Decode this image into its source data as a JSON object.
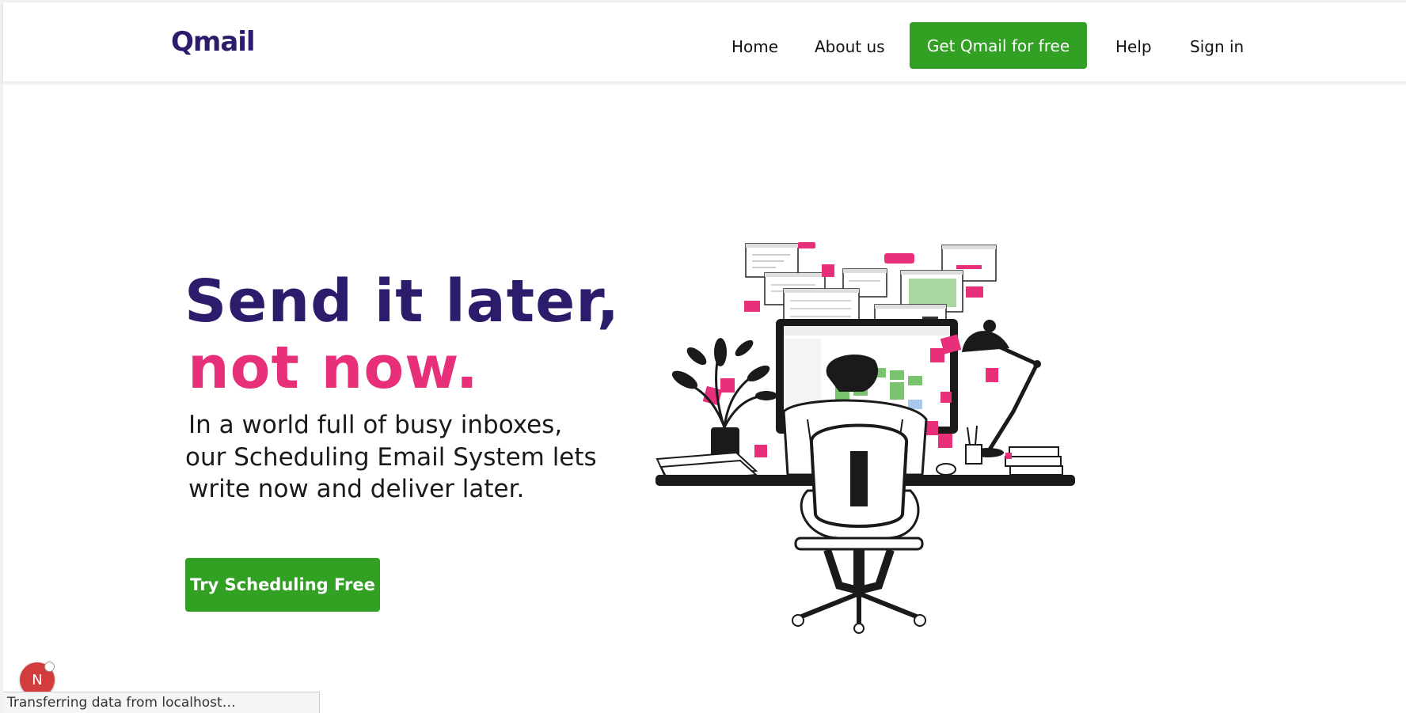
{
  "nav": {
    "logo": "Qmail",
    "home": "Home",
    "about": "About us",
    "cta": "Get Qmail for free",
    "help": "Help",
    "signin": "Sign in"
  },
  "hero": {
    "title_line1": "Send it later,",
    "title_line2": "not now.",
    "desc_line1": "In a world full of busy inboxes,",
    "desc_line2": "our Scheduling Email System lets",
    "desc_line3": "write now and deliver later.",
    "button": "Try Scheduling Free"
  },
  "colors": {
    "brand_purple": "#2d1b6b",
    "accent_pink": "#e8307a",
    "cta_green": "#31a023"
  },
  "dev": {
    "badge_letter": "N"
  },
  "status": {
    "text": "Transferring data from localhost…"
  }
}
